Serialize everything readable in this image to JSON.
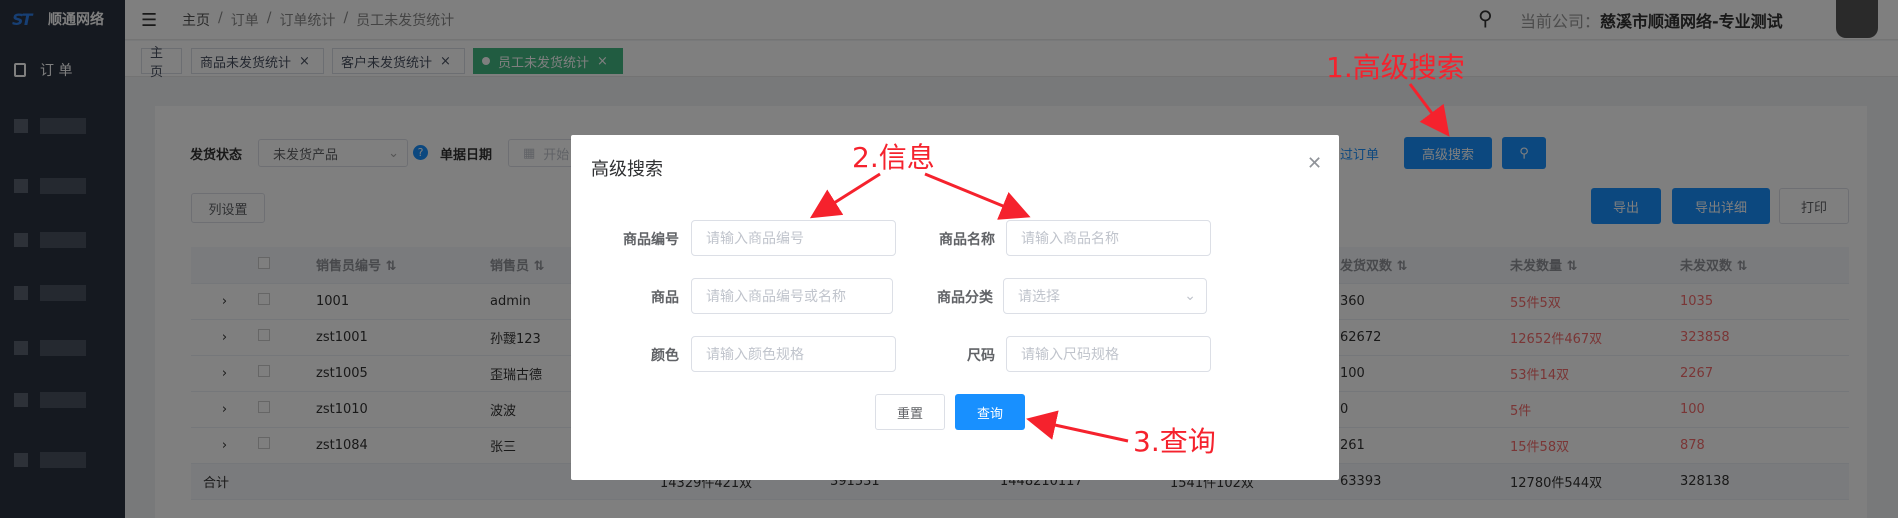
{
  "app": {
    "logo_text": "顺通网络"
  },
  "breadcrumb": [
    "主页",
    "订单",
    "订单统计",
    "员工未发货统计"
  ],
  "header": {
    "company_label": "当前公司：",
    "company_name": "慈溪市顺通网络-专业测试"
  },
  "sidebar": {
    "order_label": "订 单"
  },
  "tabs": [
    {
      "label": "主页"
    },
    {
      "label": "商品未发货统计"
    },
    {
      "label": "客户未发货统计"
    },
    {
      "label": "员工未发货统计"
    }
  ],
  "filters": {
    "status_label": "发货状态",
    "status_value": "未发货产品",
    "date_label": "单据日期",
    "date_placeholder": "开始",
    "filter_link": "过订单",
    "advanced_search": "高级搜索"
  },
  "toolbar": {
    "column_settings": "列设置",
    "export": "导出",
    "export_detail": "导出详细",
    "print": "打印"
  },
  "table": {
    "columns": [
      "销售员编号",
      "销售员",
      "",
      "",
      "",
      "",
      "发货双数",
      "未发数量",
      "未发双数"
    ],
    "rows": [
      {
        "code": "1001",
        "name": "admin",
        "shipped_pairs": "360",
        "unshipped_qty": "55件5双",
        "unshipped_pairs": "1035"
      },
      {
        "code": "zst1001",
        "name": "孙靉123",
        "shipped_pairs": "62672",
        "unshipped_qty": "12652件467双",
        "unshipped_pairs": "323858"
      },
      {
        "code": "zst1005",
        "name": "歪瑞古德",
        "shipped_pairs": "100",
        "unshipped_qty": "53件14双",
        "unshipped_pairs": "2267"
      },
      {
        "code": "zst1010",
        "name": "波波",
        "shipped_pairs": "0",
        "unshipped_qty": "5件",
        "unshipped_pairs": "100"
      },
      {
        "code": "zst1084",
        "name": "张三",
        "shipped_pairs": "261",
        "unshipped_qty": "15件58双",
        "unshipped_pairs": "878"
      }
    ],
    "total": {
      "label": "合计",
      "c3": "14329件421双",
      "c4": "391531",
      "c5": "1448210117",
      "c6": "1541件102双",
      "shipped_pairs": "63393",
      "unshipped_qty": "12780件544双",
      "unshipped_pairs": "328138"
    }
  },
  "dialog": {
    "title": "高级搜索",
    "fields": {
      "product_code_label": "商品编号",
      "product_code_placeholder": "请输入商品编号",
      "product_name_label": "商品名称",
      "product_name_placeholder": "请输入商品名称",
      "product_label": "商品",
      "product_placeholder": "请输入商品编号或名称",
      "category_label": "商品分类",
      "category_placeholder": "请选择",
      "color_label": "颜色",
      "color_placeholder": "请输入颜色规格",
      "size_label": "尺码",
      "size_placeholder": "请输入尺码规格"
    },
    "reset": "重置",
    "query": "查询"
  },
  "annotations": {
    "a1": "1.高级搜索",
    "a2": "2.信息",
    "a3": "3.查询",
    "color": "#f5222d"
  }
}
